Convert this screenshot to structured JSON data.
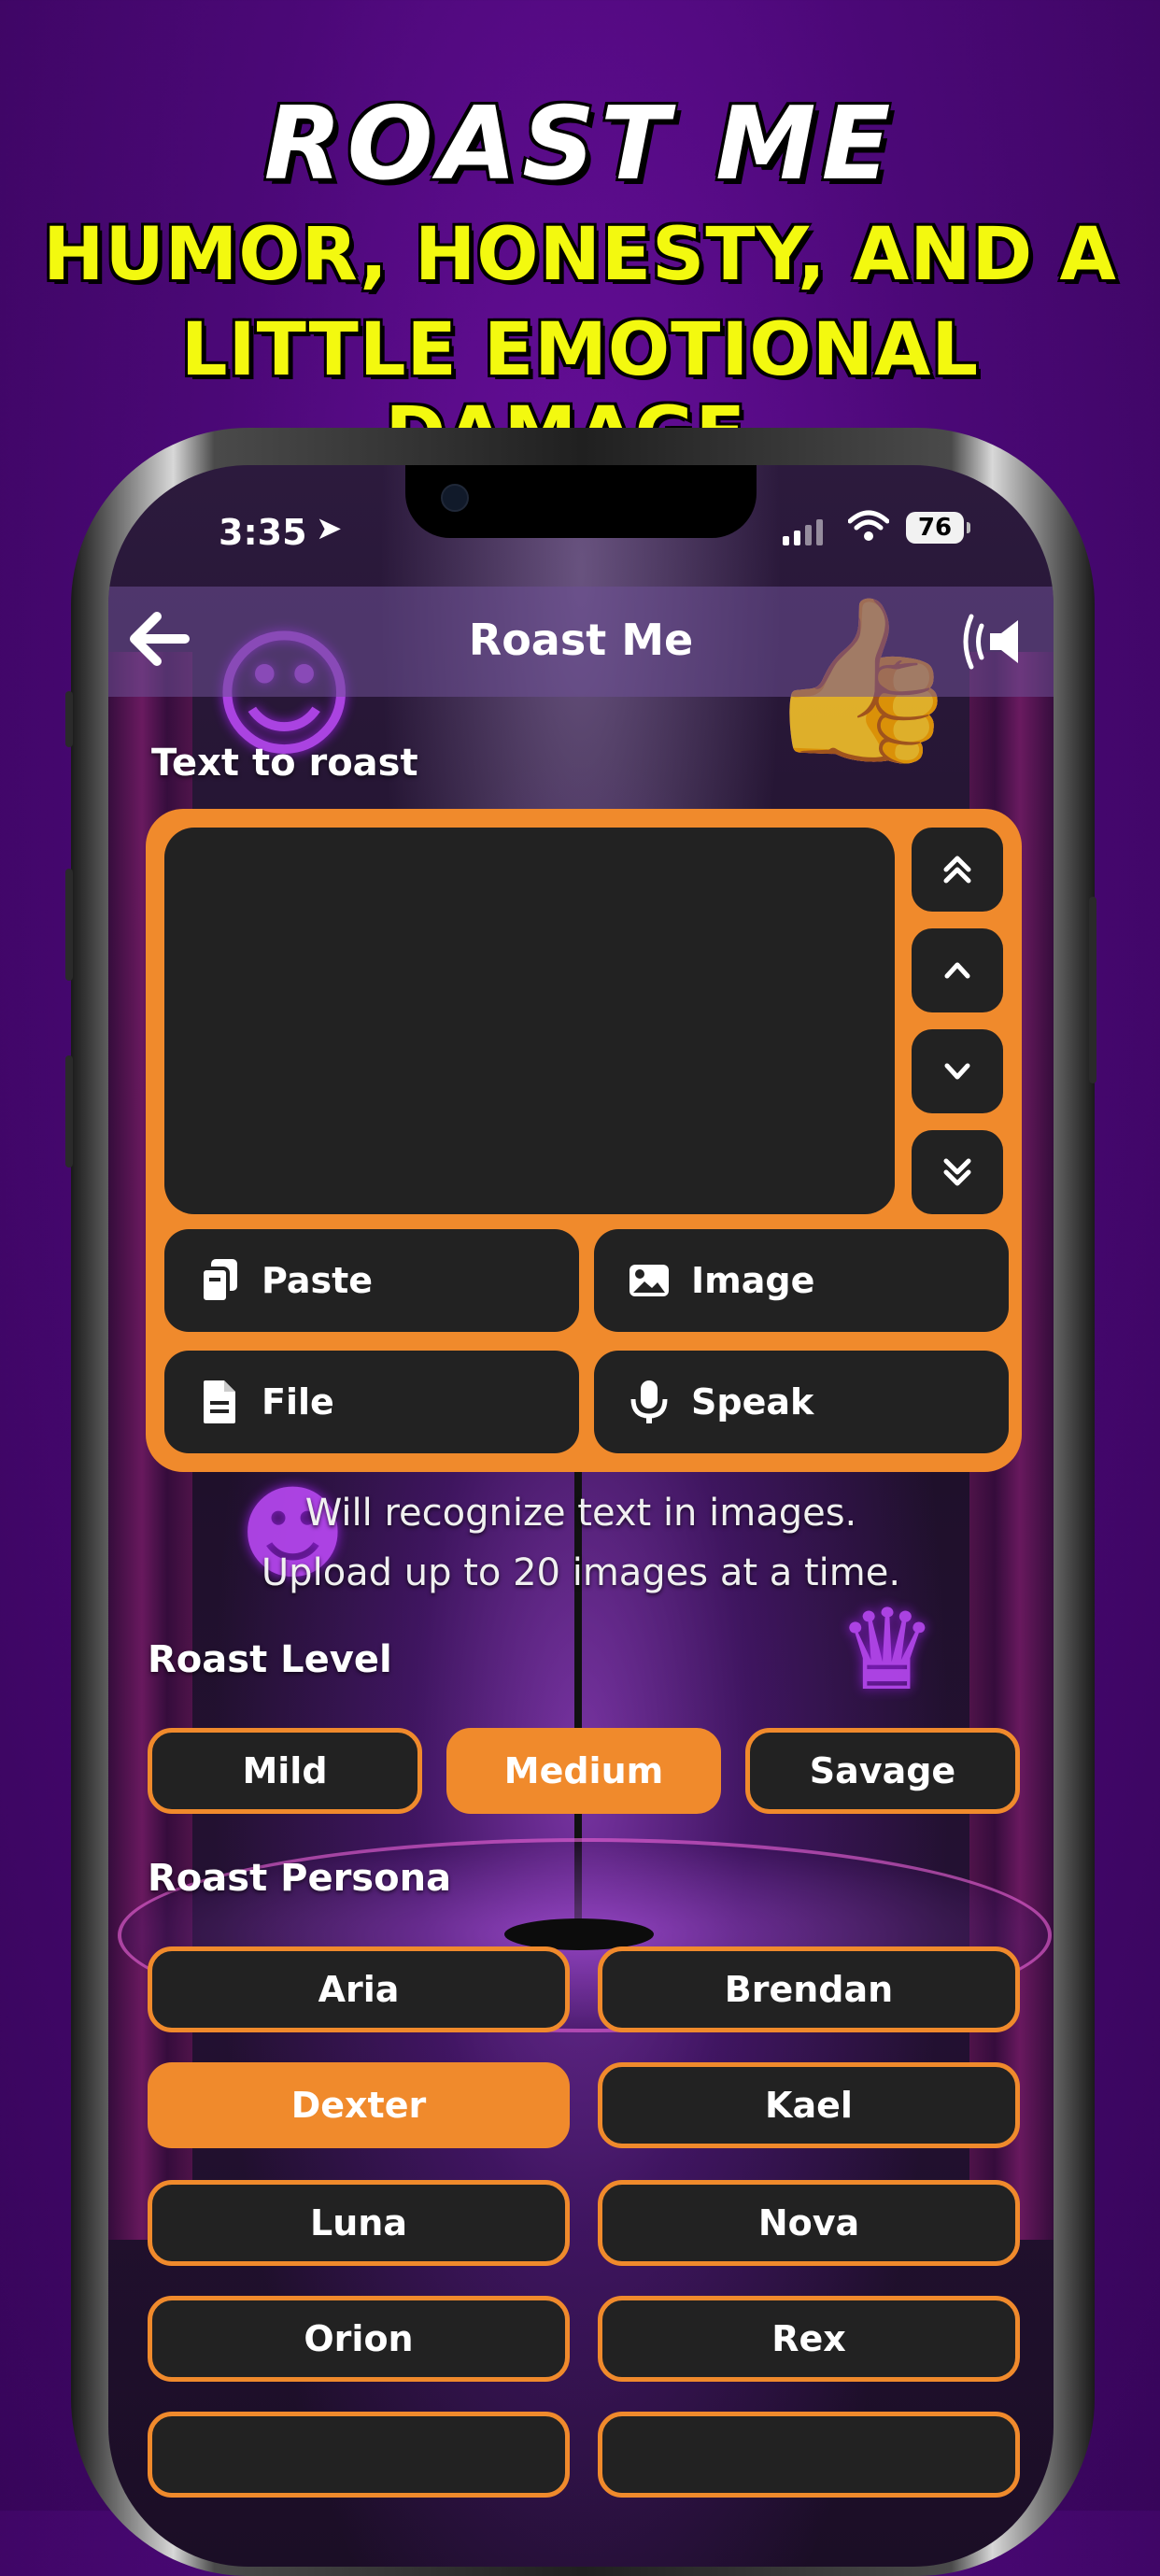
{
  "promo": {
    "title": "ROAST ME",
    "subtitle_line1": "Humor, honesty, and  a",
    "subtitle_line2": "little emotional damage."
  },
  "status_bar": {
    "time": "3:35",
    "battery": "76"
  },
  "nav": {
    "title": "Roast Me",
    "back_icon": "arrow-left-icon",
    "speaker_icon": "speaker-icon"
  },
  "input": {
    "label": "Text to roast",
    "value": "",
    "placeholder": "",
    "scroll_buttons": [
      "scroll-to-top-icon",
      "scroll-up-icon",
      "scroll-down-icon",
      "scroll-to-bottom-icon"
    ],
    "actions": [
      {
        "label": "Paste",
        "icon": "clipboard-icon"
      },
      {
        "label": "Image",
        "icon": "image-icon"
      },
      {
        "label": "File",
        "icon": "file-icon"
      },
      {
        "label": "Speak",
        "icon": "microphone-icon"
      }
    ],
    "hint_line1": "Will recognize text in images.",
    "hint_line2": "Upload up to 20 images at a time."
  },
  "roast_level": {
    "label": "Roast Level",
    "options": [
      "Mild",
      "Medium",
      "Savage"
    ],
    "selected": "Medium"
  },
  "roast_persona": {
    "label": "Roast Persona",
    "options": [
      "Aria",
      "Brendan",
      "Dexter",
      "Kael",
      "Luna",
      "Nova",
      "Orion",
      "Rex"
    ],
    "selected": "Dexter"
  },
  "colors": {
    "accent": "#f08a2c",
    "promo_subtitle": "#f3f90f",
    "button_bg": "#222222"
  }
}
